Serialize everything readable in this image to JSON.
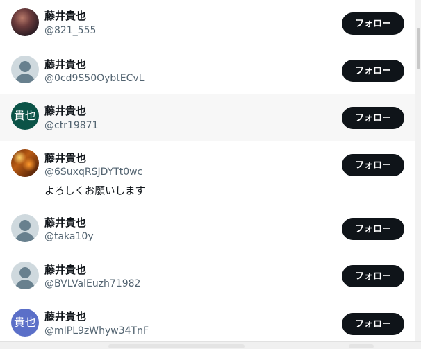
{
  "users": [
    {
      "name": "藤井貴也",
      "handle": "@821_555",
      "bio": "",
      "avatar_type": "photo",
      "avatar_text": "",
      "avatar_color": "#6b3b3c",
      "follow_label": "フォロー"
    },
    {
      "name": "藤井貴也",
      "handle": "@0cd9S50OybtECvL",
      "bio": "",
      "avatar_type": "default",
      "avatar_text": "",
      "avatar_color": "#cfd9de",
      "follow_label": "フォロー"
    },
    {
      "name": "藤井貴也",
      "handle": "@ctr19871",
      "bio": "",
      "avatar_type": "text",
      "avatar_text": "貴也",
      "avatar_color": "#0b5347",
      "follow_label": "フォロー"
    },
    {
      "name": "藤井貴也",
      "handle": "@6SuxqRSJDYTt0wc",
      "bio": "よろしくお願いします",
      "avatar_type": "photo",
      "avatar_text": "",
      "avatar_color": "#b95b14",
      "follow_label": "フォロー"
    },
    {
      "name": "藤井貴也",
      "handle": "@taka10y",
      "bio": "",
      "avatar_type": "default",
      "avatar_text": "",
      "avatar_color": "#cfd9de",
      "follow_label": "フォロー"
    },
    {
      "name": "藤井貴也",
      "handle": "@BVLValEuzh71982",
      "bio": "",
      "avatar_type": "default",
      "avatar_text": "",
      "avatar_color": "#cfd9de",
      "follow_label": "フォロー"
    },
    {
      "name": "藤井貴也",
      "handle": "@mIPL9zWhyw34TnF",
      "bio": "",
      "avatar_type": "text",
      "avatar_text": "貴也",
      "avatar_color": "#5b6fc8",
      "follow_label": "フォロー"
    }
  ],
  "colors": {
    "button_bg": "#0f1419",
    "button_text": "#ffffff",
    "handle_text": "#536471",
    "hover_row": "#f7f7f7"
  }
}
